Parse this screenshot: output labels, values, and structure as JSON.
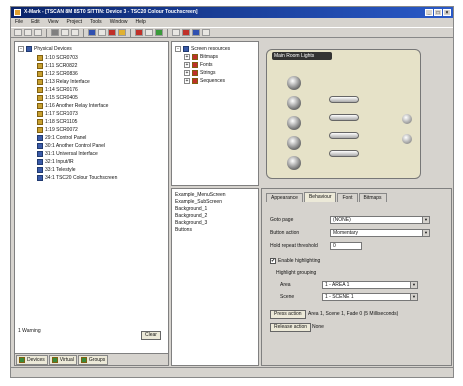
{
  "window": {
    "title": "X-Mark - [TSCAN 8M 8ST0 SITTIN: Device 3 - TSC20 Colour Touchscreen]",
    "minimize": "_",
    "maximize": "□",
    "close": "×"
  },
  "menu": [
    "File",
    "Edit",
    "View",
    "Project",
    "Tools",
    "Window",
    "Help"
  ],
  "tree": {
    "root_label": "Physical Devices",
    "items": [
      "1:10 SCR0703",
      "1:11 SCR0822",
      "1:12 SCR0836",
      "1:13 Relay Interface",
      "1:14 SCR0176",
      "1:15 SCR0405",
      "1:16 Another Relay Interface",
      "1:17 SCR1073",
      "1:18 SCR1105",
      "1:19 SCR0072",
      "29:1 Control Panel",
      "30:1 Another Control Panel",
      "31:1 Universal Interface",
      "32:1 Input/IR",
      "33:1 Telestyle",
      "34:1 TSC20 Colour Touchscreen"
    ]
  },
  "left_status": {
    "left": "1 Warning",
    "right": "Clear"
  },
  "left_tabs": [
    "Devices",
    "Virtual",
    "Groups"
  ],
  "screen_tree": {
    "root": "Screen resources",
    "items": [
      "Bitmaps",
      "Fonts",
      "Strings",
      "Sequences"
    ]
  },
  "screen_list": [
    "Example_MenuScreen",
    "Example_SubScreen",
    "Background_1",
    "Background_2",
    "Background_3",
    "Buttons"
  ],
  "preview": {
    "panel_title": "Main Room Lights"
  },
  "props": {
    "tabs": [
      "Appearance",
      "Behaviour",
      "Font",
      "Bitmaps"
    ],
    "active_tab": "Behaviour",
    "go_to_page_label": "Goto page",
    "go_to_page_value": "(NONE)",
    "button_action_label": "Button action",
    "button_action_value": "Momentary",
    "hold_threshold_label": "Hold repeat threshold",
    "hold_threshold_value": "0",
    "enable_highlighting_label": "Enable highlighting",
    "enable_highlighting_checked": "✔",
    "highlight_grouping_label": "Highlight grouping",
    "area_label": "Area",
    "area_value": "1 - AREA 1",
    "scene_label": "Scene",
    "scene_value": "1 - SCENE 1",
    "press_action_label": "Press action",
    "press_action_value": "Area 1, Scene 1, Fade 0 (5 Milliseconds)",
    "release_action_label": "Release action",
    "release_action_value": "None"
  }
}
